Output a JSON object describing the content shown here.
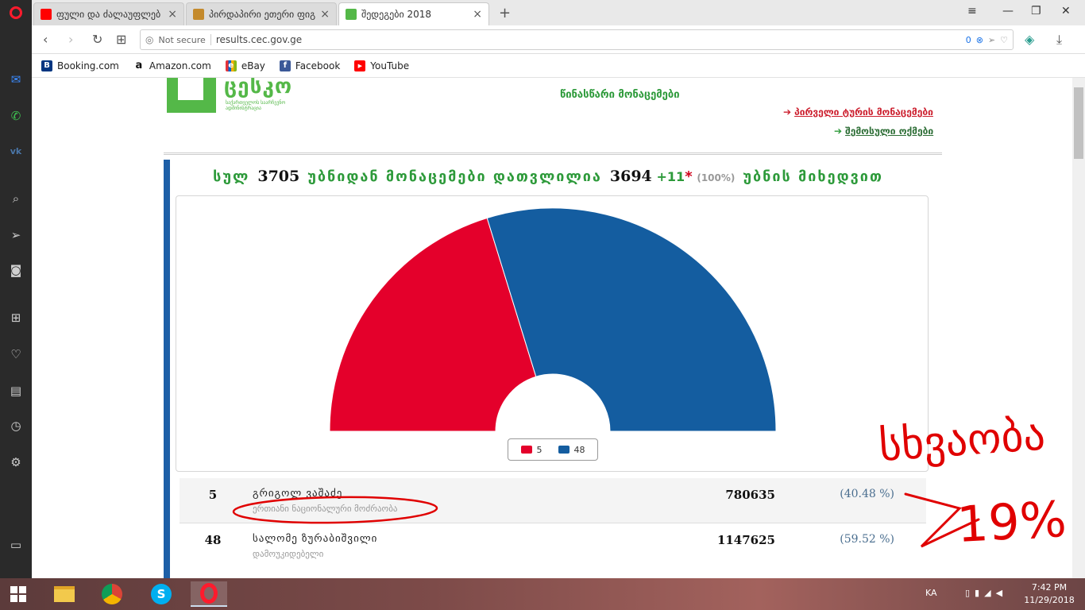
{
  "browser": {
    "tabs": [
      {
        "title": "ფული და ძალაუფლებ",
        "favicon_color": "#ff0000",
        "active": false
      },
      {
        "title": "პირდაპირი ეთერი ფიგ",
        "favicon_color": "#c48a2c",
        "active": false
      },
      {
        "title": "შედეგები 2018",
        "favicon_color": "#54b848",
        "active": true
      }
    ],
    "new_tab_symbol": "+",
    "address": {
      "security": "Not secure",
      "url": "results.cec.gov.ge",
      "block_count": "0"
    },
    "bookmarks": [
      {
        "label": "Booking.com",
        "icon": "booking-icon",
        "color": "#003580",
        "glyph": "B"
      },
      {
        "label": "Amazon.com",
        "icon": "amazon-icon",
        "color": "#111111",
        "glyph": "a"
      },
      {
        "label": "eBay",
        "icon": "ebay-icon",
        "color": "#e53238",
        "glyph": "e"
      },
      {
        "label": "Facebook",
        "icon": "facebook-icon",
        "color": "#3b5998",
        "glyph": "f"
      },
      {
        "label": "YouTube",
        "icon": "youtube-icon",
        "color": "#ff0000",
        "glyph": "▶"
      }
    ]
  },
  "page": {
    "logo_text": "ცესკო",
    "logo_subtitle": "საქართველოს საარჩევნო ადმინისტრაცია",
    "prelim_heading": "წინასწარი მონაცემები",
    "links": {
      "first_round": "პირველი ტურის მონაცემები",
      "counted_precincts": "შემოსული ოქმები"
    },
    "summary": {
      "prefix": "სულ",
      "total": "3705",
      "middle": "უბნიდან მონაცემები დათვლილია",
      "counted": "3694",
      "plus": "+11",
      "star": "*",
      "percent": "(100%)",
      "suffix": "უბნის მიხედვით"
    },
    "candidates": [
      {
        "number": "5",
        "name": "გრიგოლ ვაშაძე",
        "party": "ერთიანი ნაციონალური მოძრაობა",
        "votes": "780635",
        "percent": "(40.48 %)",
        "color": "#e4002b"
      },
      {
        "number": "48",
        "name": "სალომე ზურაბიშვილი",
        "party": "დამოუკიდებელი",
        "votes": "1147625",
        "percent": "(59.52 %)",
        "color": "#145da0"
      }
    ],
    "annotation": {
      "word": "სხვაობა",
      "value": "19%"
    }
  },
  "chart_data": {
    "type": "pie",
    "variant": "semi-donut",
    "categories": [
      "5",
      "48"
    ],
    "values": [
      40.48,
      59.52
    ],
    "colors": [
      "#e4002b",
      "#145da0"
    ],
    "legend_position": "bottom-center"
  },
  "taskbar": {
    "language": "KA",
    "time": "7:42 PM",
    "date": "11/29/2018"
  }
}
